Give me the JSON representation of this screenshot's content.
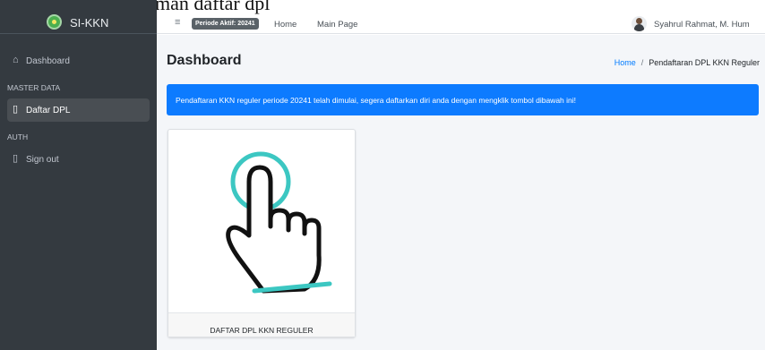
{
  "caption": "Berikut adalah halaman daftar dpl",
  "brand": {
    "name": "SI-KKN"
  },
  "sidebar": {
    "items": [
      {
        "label": "Dashboard",
        "icon": "home-icon"
      },
      {
        "header": "MASTER DATA"
      },
      {
        "label": "Daftar DPL",
        "icon": "clipboard-icon",
        "active": true
      },
      {
        "header": "AUTH"
      },
      {
        "label": "Sign out",
        "icon": "sign-out-icon"
      }
    ]
  },
  "topbar": {
    "menu_icon": "menu-icon",
    "period_badge": "Periode Aktif: 20241",
    "links": [
      "Home",
      "Main Page"
    ],
    "user": "Syahrul Rahmat, M. Hum"
  },
  "page": {
    "title": "Dashboard",
    "breadcrumb": [
      "Home",
      "Pendaftaran DPL KKN Reguler"
    ]
  },
  "alert": {
    "text": "Pendaftaran KKN reguler periode 20241 telah dimulai, segera daftarkan diri anda dengan mengklik tombol dibawah ini!"
  },
  "card": {
    "image_icon": "hand-pointer-icon",
    "footer_label": "DAFTAR DPL KKN REGULER"
  },
  "colors": {
    "sidebar_bg": "#343a40",
    "alert_bg": "#0d7bff",
    "accent_teal": "#3cc7c2"
  }
}
